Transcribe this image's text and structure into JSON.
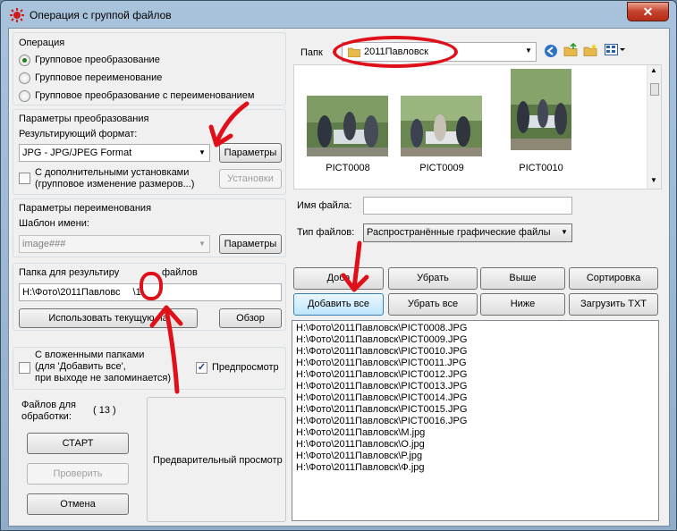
{
  "window": {
    "title": "Операция с группой файлов",
    "close_label": "✕"
  },
  "operation": {
    "label": "Операция",
    "options": [
      "Групповое преобразование",
      "Групповое переименование",
      "Групповое преобразование с переименованием"
    ],
    "selected_index": 0
  },
  "conversion": {
    "label": "Параметры преобразования",
    "format_label": "Результирующий формат:",
    "format_value": "JPG - JPG/JPEG Format",
    "params_button": "Параметры",
    "extra_line1": "С дополнительными установками",
    "extra_line2": "(групповое изменение размеров...)",
    "settings_button": "Установки"
  },
  "rename": {
    "label": "Параметры переименования",
    "template_label": "Шаблон имени:",
    "template_value": "image###",
    "params_button": "Параметры"
  },
  "output": {
    "label": "Папка для результиру",
    "label_tail": "файлов",
    "path": "H:\\Фото\\2011Павловс",
    "path_tail": "\\1",
    "use_current_button": "Использовать текущую па",
    "browse_button": "Обзор"
  },
  "options": {
    "subfolders_line1": "С вложенными папками",
    "subfolders_line2": "(для 'Добавить все',",
    "subfolders_line3": "при выходе не запоминается)",
    "preview_label": "Предпросмотр",
    "preview_checked": true
  },
  "files": {
    "count_label_line1": "Файлов для",
    "count_label_line2": "обработки:",
    "count": "( 13 )"
  },
  "actions": {
    "start": "СТАРТ",
    "check": "Проверить",
    "cancel": "Отмена"
  },
  "preview": {
    "label": "Предварительный просмотр"
  },
  "browser": {
    "folder_label": "Папк",
    "folder_value": "2011Павловск",
    "thumbnails": [
      "PICT0008",
      "PICT0009",
      "PICT0010"
    ],
    "filename_label": "Имя файла:",
    "filename_value": "",
    "filetype_label": "Тип файлов:",
    "filetype_value": "Распространённые графические файлы"
  },
  "list_buttons": {
    "add": "Доба",
    "remove": "Убрать",
    "up": "Выше",
    "sort": "Сортировка",
    "add_all": "Добавить все",
    "remove_all": "Убрать все",
    "down": "Ниже",
    "load_txt": "Загрузить TXT"
  },
  "file_list": [
    "H:\\Фото\\2011Павловск\\PICT0008.JPG",
    "H:\\Фото\\2011Павловск\\PICT0009.JPG",
    "H:\\Фото\\2011Павловск\\PICT0010.JPG",
    "H:\\Фото\\2011Павловск\\PICT0011.JPG",
    "H:\\Фото\\2011Павловск\\PICT0012.JPG",
    "H:\\Фото\\2011Павловск\\PICT0013.JPG",
    "H:\\Фото\\2011Павловск\\PICT0014.JPG",
    "H:\\Фото\\2011Павловск\\PICT0015.JPG",
    "H:\\Фото\\2011Павловск\\PICT0016.JPG",
    "H:\\Фото\\2011Павловск\\M.jpg",
    "H:\\Фото\\2011Павловск\\O.jpg",
    "H:\\Фото\\2011Павловск\\P.jpg",
    "H:\\Фото\\2011Павловск\\Ф.jpg"
  ],
  "colors": {
    "annotation_red": "#e0101a",
    "folder_yellow": "#e8b84a"
  }
}
